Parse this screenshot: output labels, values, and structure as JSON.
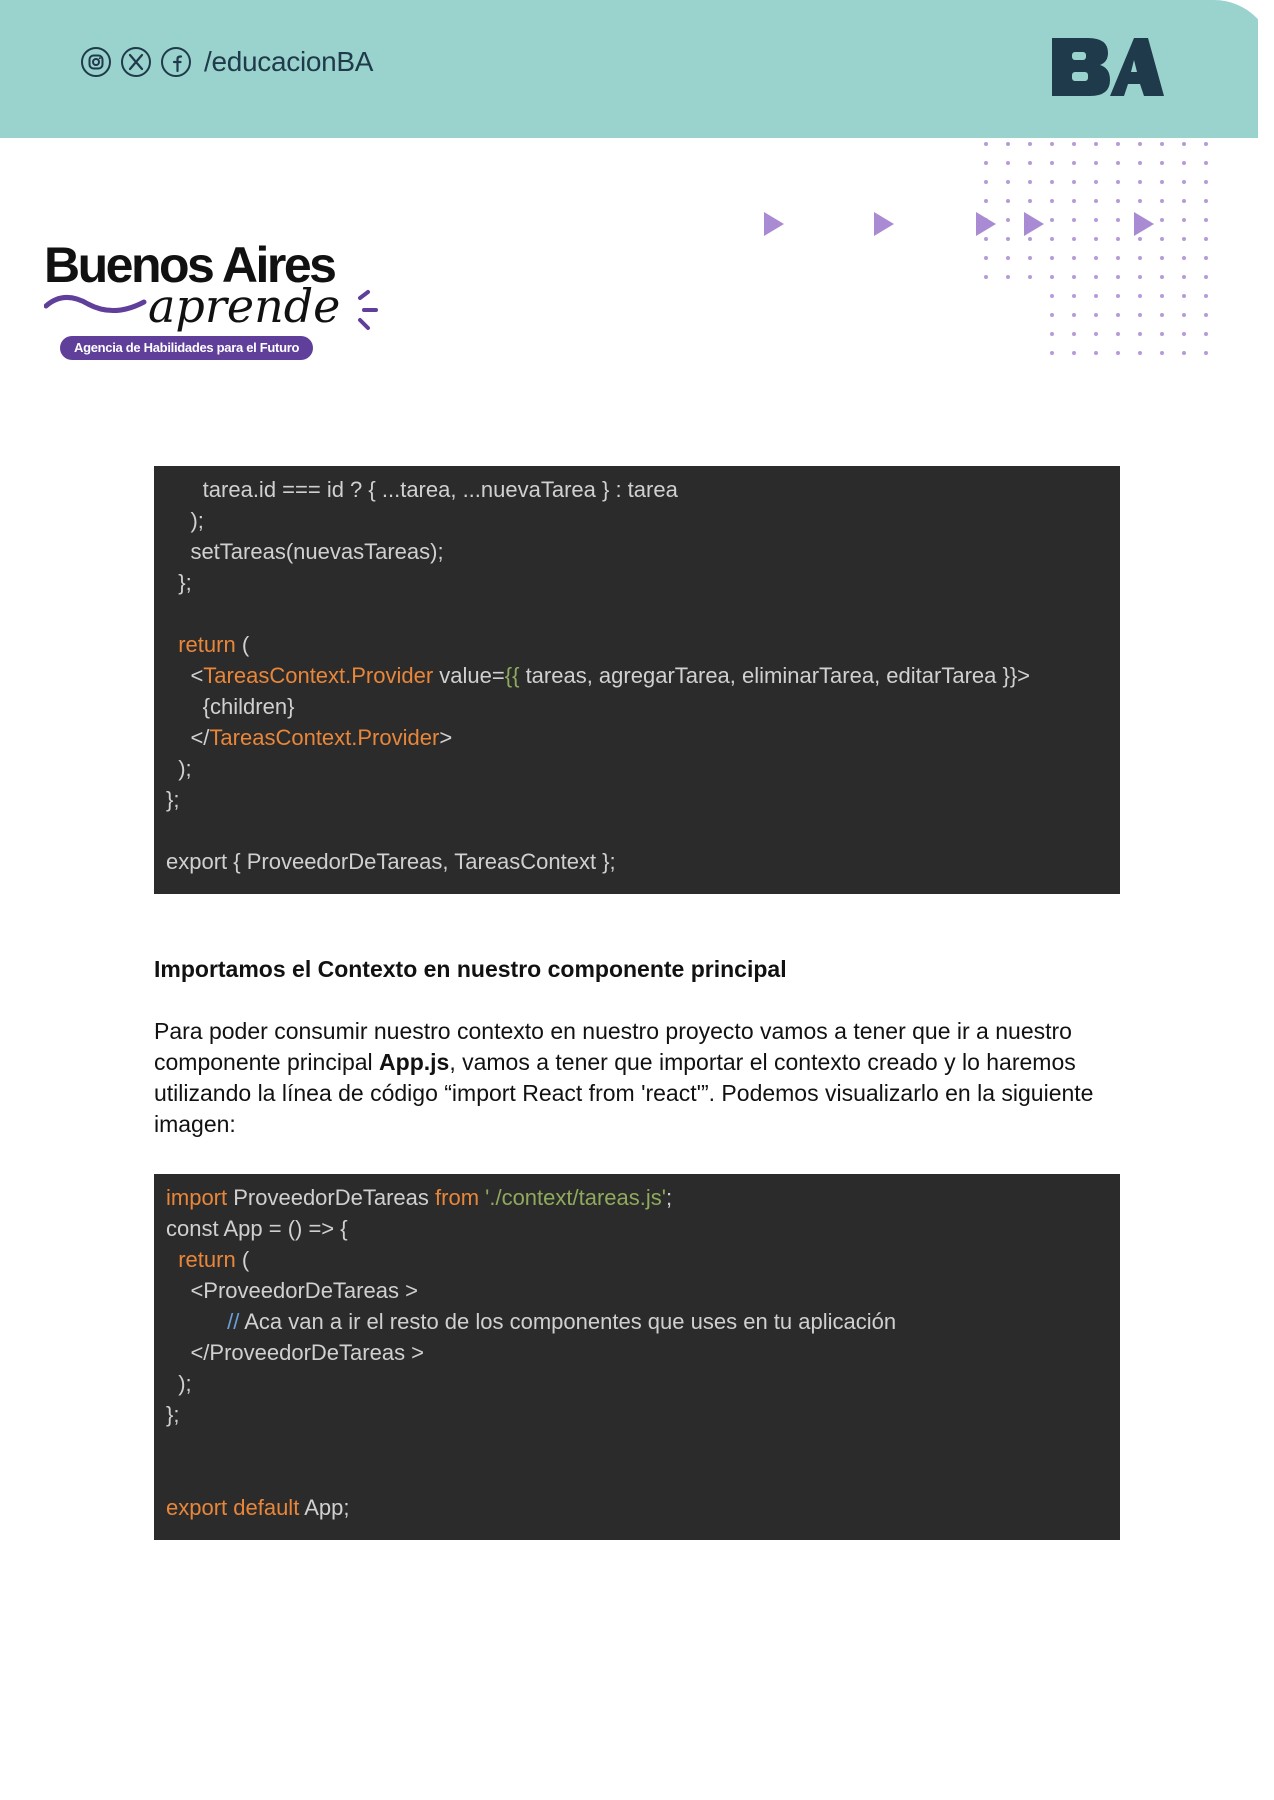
{
  "header": {
    "social_handle": "/educacionBA",
    "social_icons": [
      "instagram-icon",
      "x-icon",
      "facebook-icon"
    ],
    "logo_text": "BA",
    "band_color": "#9ad3ce",
    "logo_color": "#1f3a4a"
  },
  "brand": {
    "title": "Buenos Aires",
    "script": "aprende",
    "badge": "Agencia de Habilidades para el Futuro",
    "accent_color": "#5f3f99"
  },
  "code_block_1": {
    "lines": [
      [
        {
          "t": "      tarea.id === id ? { ...tarea, ...nuevaTarea } : tarea"
        }
      ],
      [
        {
          "t": "    );"
        }
      ],
      [
        {
          "t": "    setTareas(nuevasTareas);"
        }
      ],
      [
        {
          "t": "  };"
        }
      ],
      [
        {
          "t": ""
        }
      ],
      [
        {
          "t": "  "
        },
        {
          "t": "return",
          "c": "kw"
        },
        {
          "t": " ("
        }
      ],
      [
        {
          "t": "    <"
        },
        {
          "t": "TareasContext.Provider",
          "c": "kw"
        },
        {
          "t": " value="
        },
        {
          "t": "{{",
          "c": "str"
        },
        {
          "t": " tareas, agregarTarea, eliminarTarea, editarTarea }}>"
        }
      ],
      [
        {
          "t": "      {children}"
        }
      ],
      [
        {
          "t": "    </"
        },
        {
          "t": "TareasContext.Provider",
          "c": "kw"
        },
        {
          "t": ">"
        }
      ],
      [
        {
          "t": "  );"
        }
      ],
      [
        {
          "t": "};"
        }
      ],
      [
        {
          "t": ""
        }
      ],
      [
        {
          "t": "export { ProveedorDeTareas, TareasContext };"
        }
      ]
    ]
  },
  "section_title": "Importamos el Contexto en nuestro componente principal",
  "paragraph": {
    "before": "Para poder consumir nuestro contexto en nuestro proyecto vamos a tener que ir a nuestro componente principal  ",
    "bold": "App.js",
    "after": ", vamos a tener que importar el contexto creado y lo haremos utilizando la  línea de código “import React from 'react'”. Podemos visualizarlo en la siguiente imagen:"
  },
  "code_block_2": {
    "lines": [
      [
        {
          "t": "import",
          "c": "kw"
        },
        {
          "t": " ProveedorDeTareas "
        },
        {
          "t": "from",
          "c": "kw"
        },
        {
          "t": " "
        },
        {
          "t": "'./context/tareas.js'",
          "c": "str"
        },
        {
          "t": ";"
        }
      ],
      [
        {
          "t": "const App = () => {"
        }
      ],
      [
        {
          "t": "  "
        },
        {
          "t": "return",
          "c": "kw"
        },
        {
          "t": " ("
        }
      ],
      [
        {
          "t": "    <ProveedorDeTareas >"
        }
      ],
      [
        {
          "t": "          "
        },
        {
          "t": "//",
          "c": "cm"
        },
        {
          "t": " Aca van a ir el resto de los componentes que uses en tu aplicación"
        }
      ],
      [
        {
          "t": "    </ProveedorDeTareas >"
        }
      ],
      [
        {
          "t": "  );"
        }
      ],
      [
        {
          "t": "};"
        }
      ],
      [
        {
          "t": ""
        }
      ],
      [
        {
          "t": ""
        }
      ],
      [
        {
          "t": "export default",
          "c": "kw"
        },
        {
          "t": " App;"
        }
      ]
    ]
  }
}
